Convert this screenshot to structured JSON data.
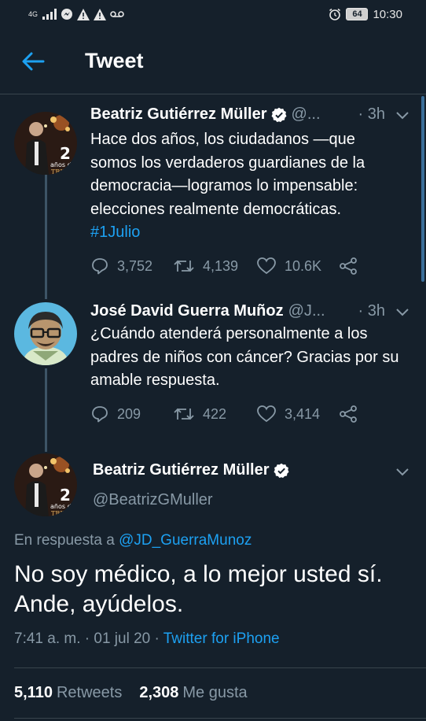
{
  "status_bar": {
    "network": "4G",
    "battery": "64",
    "time": "10:30"
  },
  "header": {
    "title": "Tweet"
  },
  "tweets": [
    {
      "name": "Beatriz Gutiérrez Müller",
      "handle": "@",
      "time": "· 3h",
      "text": "Hace dos años, los ciudadanos —que somos los verdaderos guardianes de la democracia—logramos lo impensable: elecciones realmente democráticas.",
      "hashtag": "#1Julio",
      "replies": "3,752",
      "retweets": "4,139",
      "likes": "10.6K"
    },
    {
      "name": "José David Guerra Muñoz",
      "handle": "@J",
      "time": "· 3h",
      "text": "¿Cuándo atenderá personalmente a los padres de niños con cáncer? Gracias por su amable respuesta.",
      "replies": "209",
      "retweets": "422",
      "likes": "3,414"
    }
  ],
  "main_tweet": {
    "name": "Beatriz Gutiérrez Müller",
    "handle": "@BeatrizGMuller",
    "reply_prefix": "En respuesta a ",
    "reply_handle": "@JD_GuerraMunoz",
    "text": "No soy médico, a lo mejor usted sí. Ande, ayúdelos.",
    "timestamp": "7:41 a. m. · 01 jul 20 · ",
    "source": "Twitter for iPhone",
    "retweets_count": "5,110",
    "retweets_label": "Retweets",
    "likes_count": "2,308",
    "likes_label": "Me gusta"
  },
  "colors": {
    "background": "#15202b",
    "accent": "#1da1f2",
    "secondary_text": "#8899a6",
    "divider": "#38444d"
  },
  "icons": [
    "back-arrow-icon",
    "verified-icon",
    "chevron-down-icon",
    "reply-icon",
    "retweet-icon",
    "like-icon",
    "share-icon"
  ]
}
